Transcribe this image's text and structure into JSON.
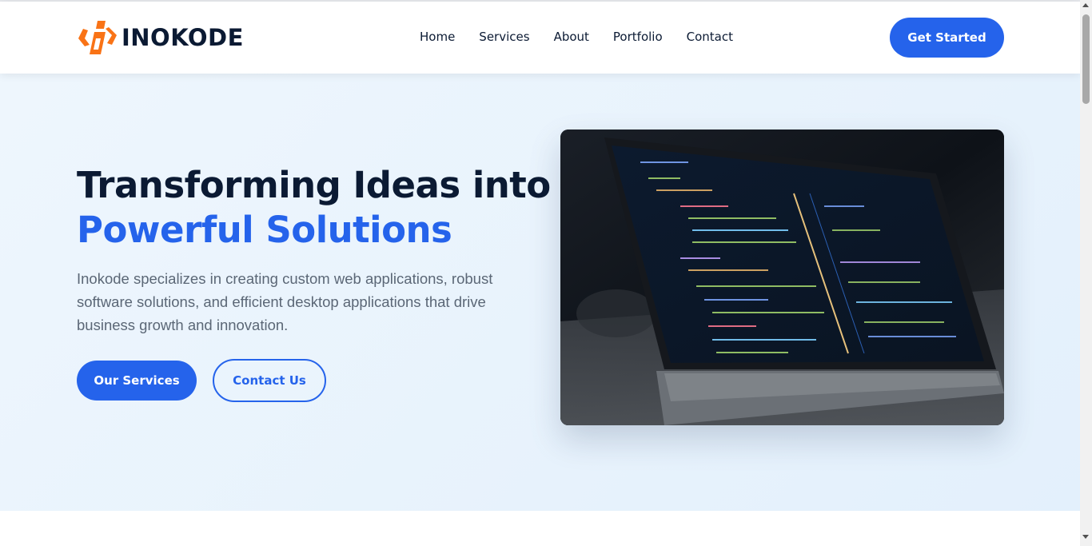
{
  "brand": {
    "name": "INOKODE",
    "logo_icon": "i-logo-icon",
    "color": "#f97316"
  },
  "nav": {
    "items": [
      {
        "label": "Home"
      },
      {
        "label": "Services"
      },
      {
        "label": "About"
      },
      {
        "label": "Portfolio"
      },
      {
        "label": "Contact"
      }
    ],
    "cta_label": "Get Started"
  },
  "hero": {
    "title_line1": "Transforming Ideas into",
    "title_line2": "Powerful Solutions",
    "description": "Inokode specializes in creating custom web applications, robust software solutions, and efficient desktop applications that drive business growth and innovation.",
    "primary_button": "Our Services",
    "secondary_button": "Contact Us",
    "image_alt": "Laptop showing code"
  },
  "colors": {
    "primary": "#2563eb",
    "heading": "#0b1a33",
    "text": "#5b6776",
    "hero_bg": "#e8f3fd"
  }
}
